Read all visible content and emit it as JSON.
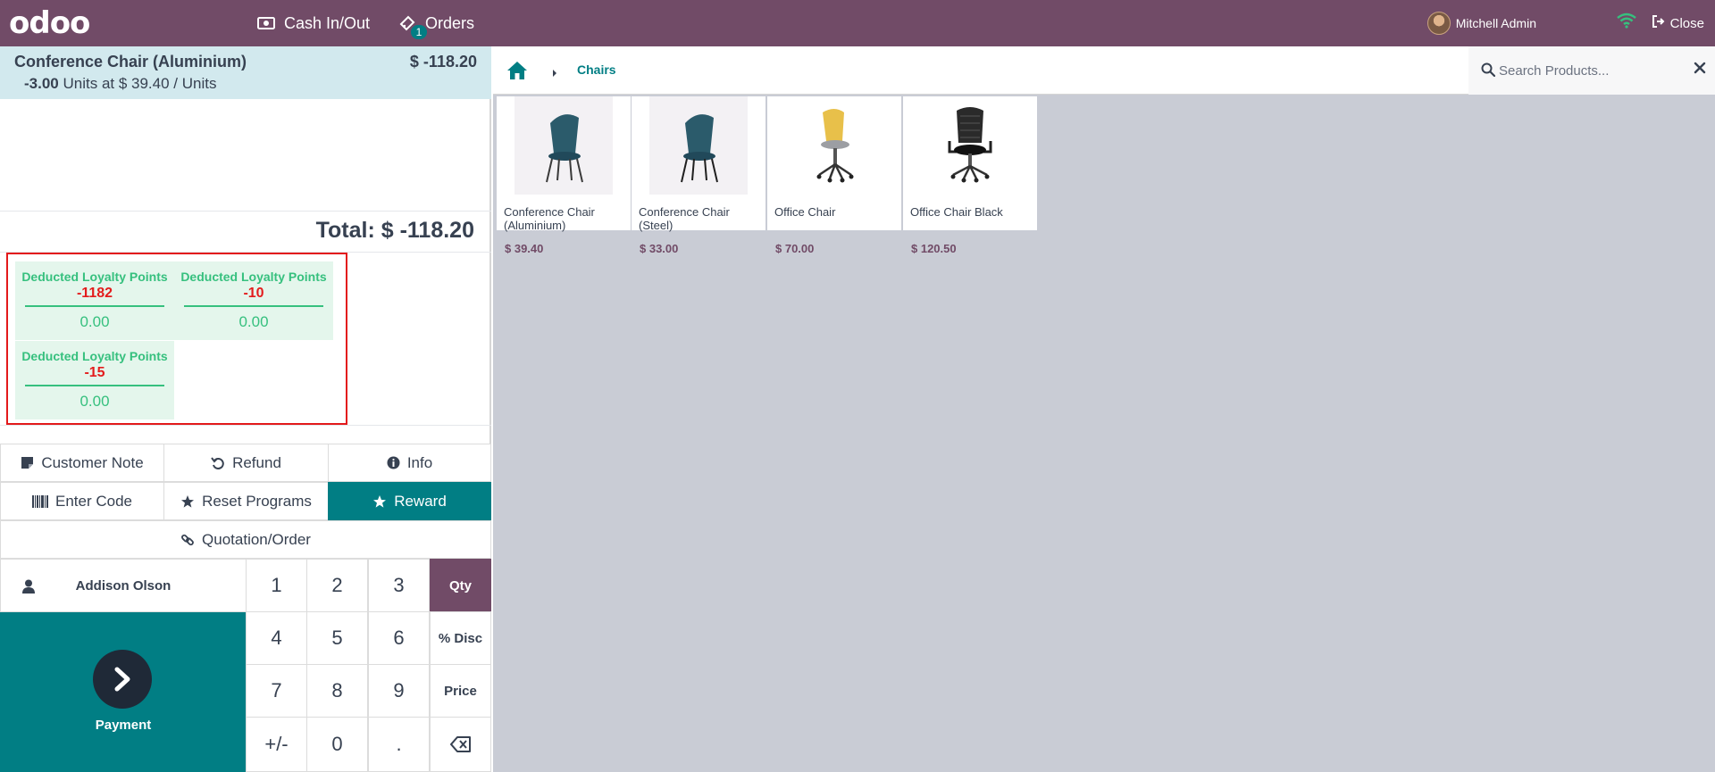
{
  "topbar": {
    "logo": "odoo",
    "cash_in_out": "Cash In/Out",
    "orders": "Orders",
    "orders_badge": "1",
    "user": "Mitchell Admin",
    "close": "Close"
  },
  "order": {
    "line": {
      "name": "Conference Chair (Aluminium)",
      "price": "$ -118.20",
      "qty": "-3.00",
      "detail": "Units at $ 39.40 / Units"
    },
    "total_label": "Total:",
    "total_value": "$ -118.20"
  },
  "loyalty": [
    {
      "title": "Deducted Loyalty Points",
      "points": "-1182",
      "value": "0.00"
    },
    {
      "title": "Deducted Loyalty Points",
      "points": "-10",
      "value": "0.00"
    },
    {
      "title": "Deducted Loyalty Points",
      "points": "-15",
      "value": "0.00"
    }
  ],
  "controls": {
    "customer_note": "Customer Note",
    "refund": "Refund",
    "info": "Info",
    "enter_code": "Enter Code",
    "reset_programs": "Reset Programs",
    "reward": "Reward",
    "quotation": "Quotation/Order"
  },
  "numpad": {
    "customer": "Addison Olson",
    "payment": "Payment",
    "keys": [
      "1",
      "2",
      "3",
      "4",
      "5",
      "6",
      "7",
      "8",
      "9",
      "+/-",
      "0",
      "."
    ],
    "qty": "Qty",
    "disc": "% Disc",
    "price": "Price"
  },
  "breadcrumb": {
    "category": "Chairs"
  },
  "search": {
    "placeholder": "Search Products..."
  },
  "products": [
    {
      "name": "Conference Chair (Aluminium)",
      "price": "$ 39.40"
    },
    {
      "name": "Conference Chair (Steel)",
      "price": "$ 33.00"
    },
    {
      "name": "Office Chair",
      "price": "$ 70.00"
    },
    {
      "name": "Office Chair Black",
      "price": "$ 120.50"
    }
  ],
  "colors": {
    "brand": "#714b67",
    "teal": "#017e84",
    "loyalty_green": "#36c07e",
    "negative_red": "#e31c1c"
  }
}
